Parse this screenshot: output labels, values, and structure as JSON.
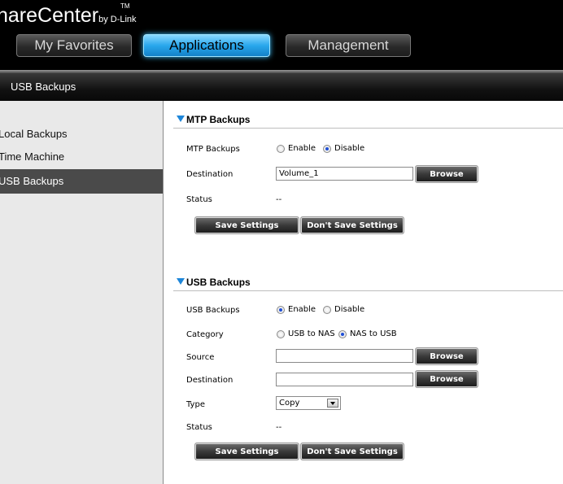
{
  "brand": {
    "name": "hareCenter",
    "trademark": "TM",
    "by": "by D-Link"
  },
  "nav": {
    "tabs": [
      {
        "label": "My Favorites",
        "active": false
      },
      {
        "label": "Applications",
        "active": true
      },
      {
        "label": "Management",
        "active": false
      }
    ]
  },
  "section": {
    "title": "USB Backups"
  },
  "sidebar": {
    "items": [
      {
        "label": "Local Backups",
        "selected": false
      },
      {
        "label": "Time Machine",
        "selected": false
      },
      {
        "label": "USB Backups",
        "selected": true
      }
    ]
  },
  "mtp": {
    "title": "MTP Backups",
    "backups_label": "MTP Backups",
    "enable_label": "Enable",
    "disable_label": "Disable",
    "enabled": false,
    "destination_label": "Destination",
    "destination_value": "Volume_1",
    "browse_label": "Browse",
    "status_label": "Status",
    "status_value": "--",
    "save_label": "Save Settings",
    "dont_save_label": "Don't Save Settings"
  },
  "usb": {
    "title": "USB Backups",
    "backups_label": "USB Backups",
    "enable_label": "Enable",
    "disable_label": "Disable",
    "enabled": true,
    "category_label": "Category",
    "usb_to_nas_label": "USB to NAS",
    "nas_to_usb_label": "NAS to USB",
    "category_value": "NAS to USB",
    "source_label": "Source",
    "source_value": "",
    "destination_label": "Destination",
    "destination_value": "",
    "browse_label": "Browse",
    "type_label": "Type",
    "type_value": "Copy",
    "status_label": "Status",
    "status_value": "--",
    "save_label": "Save Settings",
    "dont_save_label": "Don't Save Settings"
  },
  "colors": {
    "accent_blue": "#29a7ec",
    "triangle_blue": "#1e86d9",
    "sidebar_bg": "#e9e9e9",
    "sidebar_selected": "#4a4a4a"
  }
}
